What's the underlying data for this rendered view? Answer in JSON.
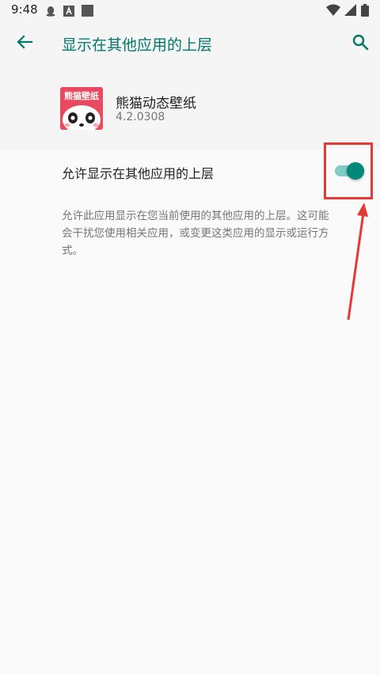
{
  "status_bar": {
    "time": "9:48",
    "notification_icons": [
      "qq-icon",
      "a-icon",
      "square-icon"
    ],
    "system_icons": [
      "wifi-icon",
      "signal-icon",
      "battery-icon"
    ]
  },
  "app_bar": {
    "title": "显示在其他应用的上层",
    "back_icon": "arrow-back-icon",
    "search_icon": "search-icon"
  },
  "app_info": {
    "name": "熊猫动态壁纸",
    "version": "4.2.0308",
    "icon_text": "熊猫壁纸"
  },
  "preference": {
    "label": "允许显示在其他应用的上层",
    "enabled": true,
    "summary": "允许此应用显示在您当前使用的其他应用的上层。这可能会干扰您使用相关应用，或变更这类应用的显示或运行方式。"
  },
  "colors": {
    "accent": "#00796b",
    "toggle_thumb": "#00897b",
    "toggle_track": "#80cbc4",
    "annotation": "#e53935"
  }
}
